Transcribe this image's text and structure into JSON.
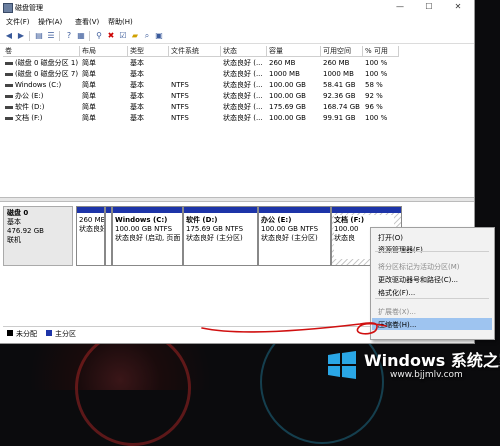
{
  "window": {
    "title": "磁盘管理",
    "controls": {
      "minimize": "—",
      "maximize": "☐",
      "close": "✕"
    }
  },
  "menu": [
    "文件(F)",
    "操作(A)",
    "查看(V)",
    "帮助(H)"
  ],
  "table": {
    "headers": [
      "卷",
      "布局",
      "类型",
      "文件系统",
      "状态",
      "容量",
      "可用空间",
      "% 可用"
    ],
    "rows": [
      [
        "(磁盘 0 磁盘分区 1)",
        "简单",
        "基本",
        "",
        "状态良好 (...",
        "260 MB",
        "260 MB",
        "100 %"
      ],
      [
        "(磁盘 0 磁盘分区 7)",
        "简单",
        "基本",
        "",
        "状态良好 (...",
        "1000 MB",
        "1000 MB",
        "100 %"
      ],
      [
        "Windows (C:)",
        "简单",
        "基本",
        "NTFS",
        "状态良好 (...",
        "100.00 GB",
        "58.41 GB",
        "58 %"
      ],
      [
        "办公 (E:)",
        "简单",
        "基本",
        "NTFS",
        "状态良好 (...",
        "100.00 GB",
        "92.36 GB",
        "92 %"
      ],
      [
        "软件 (D:)",
        "简单",
        "基本",
        "NTFS",
        "状态良好 (...",
        "175.69 GB",
        "168.74 GB",
        "96 %"
      ],
      [
        "文档 (F:)",
        "简单",
        "基本",
        "NTFS",
        "状态良好 (...",
        "100.00 GB",
        "99.91 GB",
        "100 %"
      ]
    ]
  },
  "disk": {
    "name": "磁盘 0",
    "type": "基本",
    "size": "476.92 GB",
    "status": "联机"
  },
  "partitions": [
    {
      "name": "",
      "line1": "260 MB",
      "line2": "状态良好"
    },
    {
      "name": "",
      "line1": "1000 MB",
      "line2": "状态良好"
    },
    {
      "name": "Windows (C:)",
      "line1": "100.00 GB NTFS",
      "line2": "状态良好 (启动, 页面"
    },
    {
      "name": "软件 (D:)",
      "line1": "175.69 GB NTFS",
      "line2": "状态良好 (主分区)"
    },
    {
      "name": "办公 (E:)",
      "line1": "100.00 GB NTFS",
      "line2": "状态良好 (主分区)"
    },
    {
      "name": "文档 (F:)",
      "line1": "100.00",
      "line2": "状态良"
    }
  ],
  "legend": [
    "未分配",
    "主分区"
  ],
  "context_menu": {
    "items": [
      {
        "label": "打开(O)",
        "enabled": true
      },
      {
        "label": "资源管理器(E)",
        "enabled": true
      },
      {
        "label": "将分区标记为活动分区(M)",
        "enabled": false
      },
      {
        "label": "更改驱动器号和路径(C)...",
        "enabled": true
      },
      {
        "label": "格式化(F)...",
        "enabled": true
      },
      {
        "label": "扩展卷(X)...",
        "enabled": false
      },
      {
        "label": "压缩卷(H)...",
        "enabled": true,
        "highlighted": true
      }
    ]
  },
  "watermark": {
    "title": "Windows 系统之家",
    "url": "www.bjjmlv.com"
  },
  "colors": {
    "primary_partition": "#1d34a8",
    "unallocated": "#000000",
    "menu_highlight": "#9ec4f0"
  }
}
